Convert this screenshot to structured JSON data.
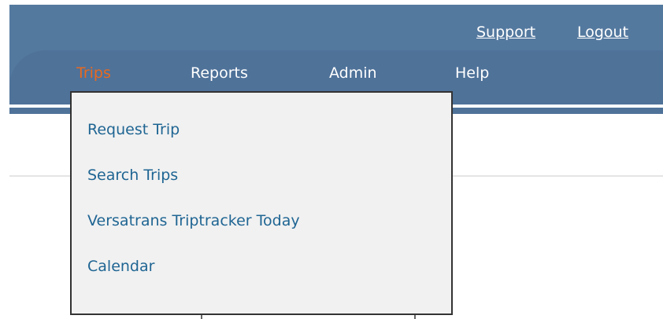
{
  "header": {
    "support_label": "Support",
    "logout_label": "Logout"
  },
  "nav": {
    "items": [
      {
        "label": "Trips",
        "active": true
      },
      {
        "label": "Reports",
        "active": false
      },
      {
        "label": "Admin",
        "active": false
      },
      {
        "label": "Help",
        "active": false
      }
    ]
  },
  "dropdown": {
    "items": [
      {
        "label": "Request Trip"
      },
      {
        "label": "Search Trips"
      },
      {
        "label": "Versatrans Triptracker Today"
      },
      {
        "label": "Calendar"
      }
    ]
  },
  "colors": {
    "header_blue": "#54799f",
    "nav_blue": "#4f7299",
    "active_orange": "#e8691f",
    "link_blue": "#1f6593",
    "menu_bg": "#f1f1f1"
  }
}
